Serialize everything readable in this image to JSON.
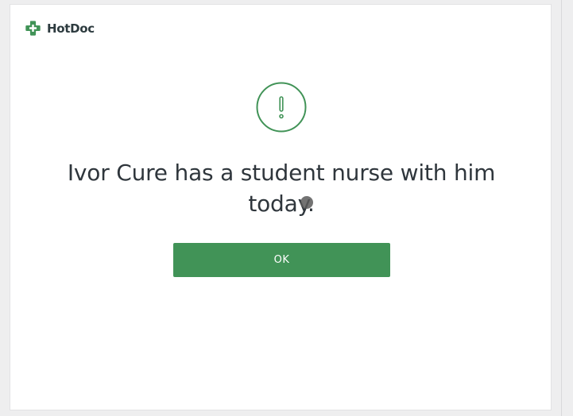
{
  "brand": {
    "name": "HotDoc",
    "icon": "plus-cross-icon",
    "color": "#419357"
  },
  "alert": {
    "icon": "exclamation-icon",
    "message": "Ivor Cure has a student nurse with him today."
  },
  "actions": {
    "ok_label": "OK"
  },
  "colors": {
    "accent": "#419357",
    "text": "#2f363c",
    "background": "#ffffff"
  }
}
